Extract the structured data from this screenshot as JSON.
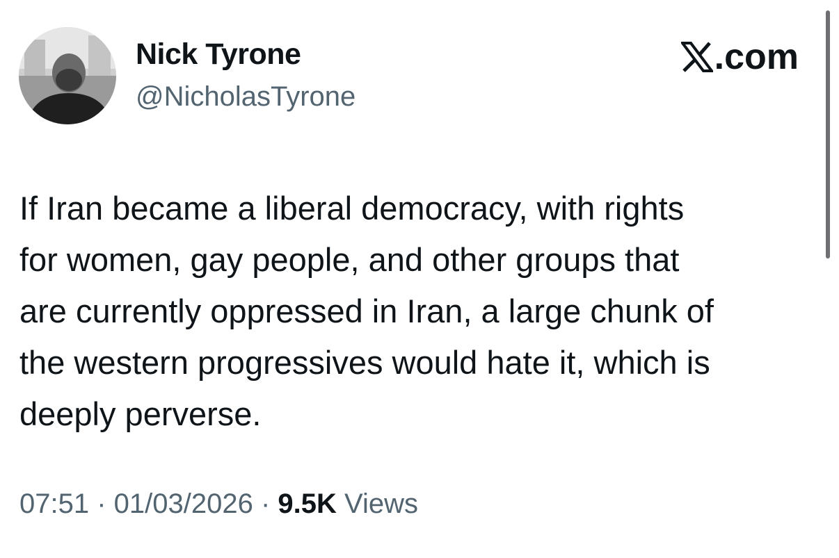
{
  "author": {
    "display_name": "Nick Tyrone",
    "handle": "@NicholasTyrone",
    "avatar_icon": "profile-photo"
  },
  "brand": {
    "logo_icon": "x-logo-icon",
    "domain": ".com"
  },
  "tweet": {
    "lines": [
      "If Iran became a liberal democracy, with rights",
      "for women, gay people, and other groups that",
      "are currently oppressed in Iran, a large chunk of",
      "the western progressives would hate it, which is",
      "deeply perverse."
    ]
  },
  "meta": {
    "time": "07:51",
    "separator": " · ",
    "date": "01/03/2026",
    "views_count": "9.5K",
    "views_label": " Views"
  },
  "colors": {
    "text": "#0f1419",
    "secondary": "#536471",
    "background": "#ffffff"
  }
}
